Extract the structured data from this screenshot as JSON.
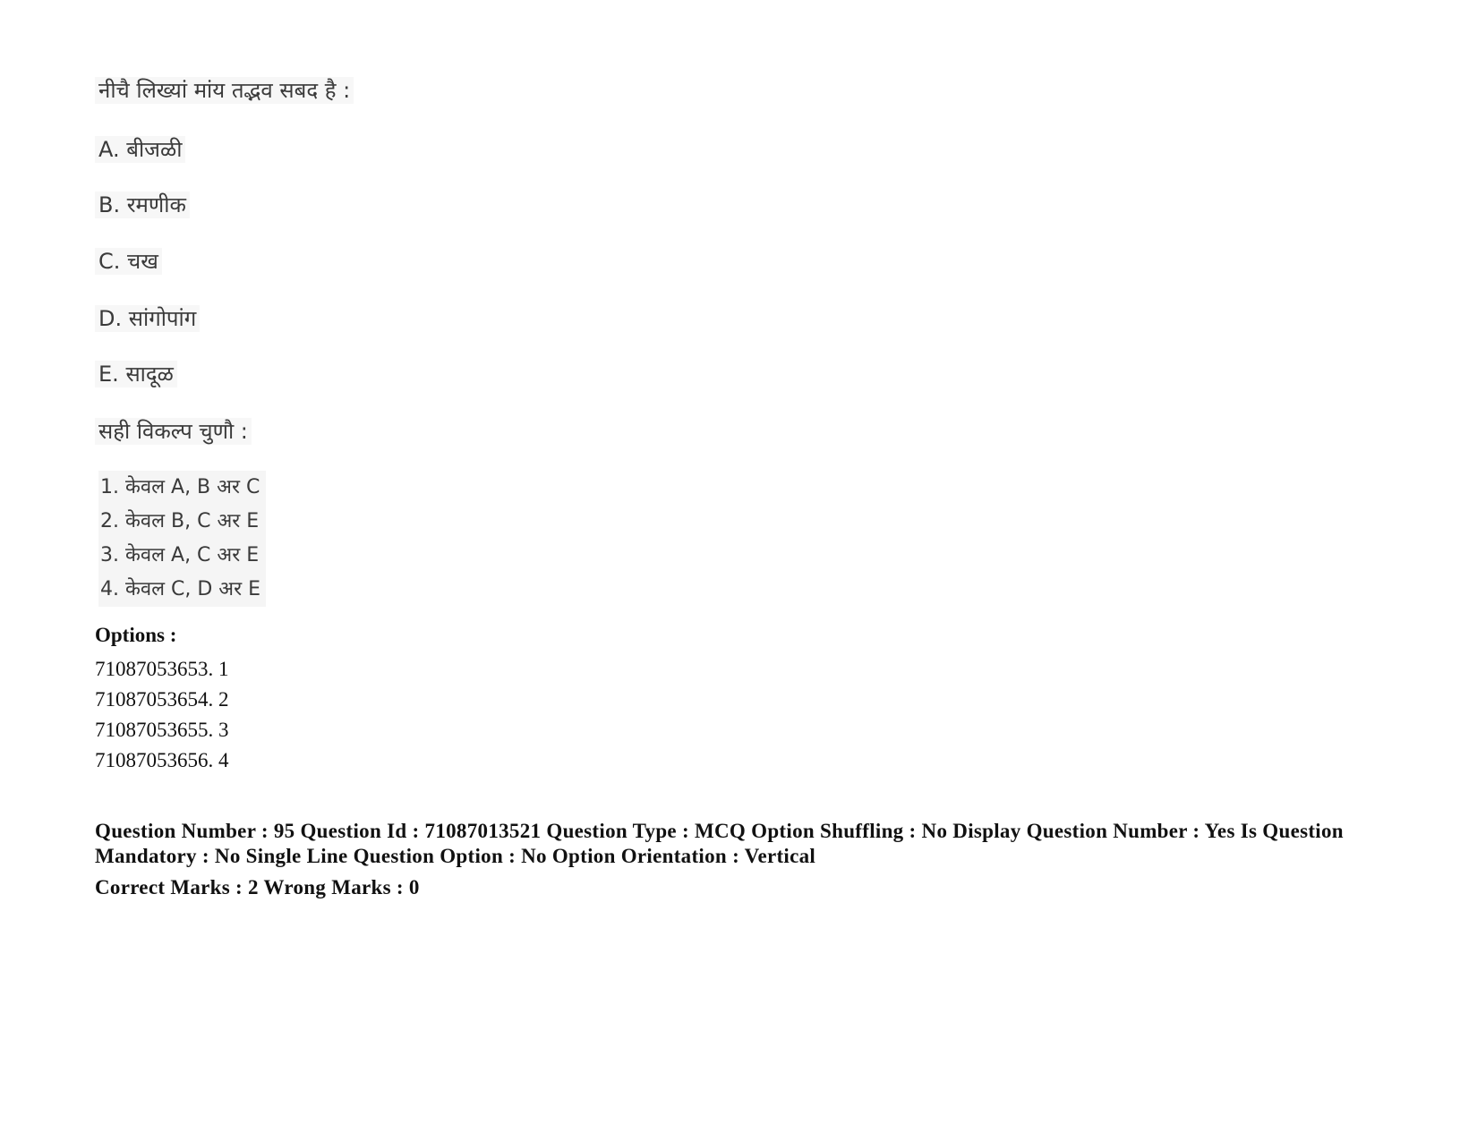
{
  "question": {
    "title": "नीचै लिख्यां मांय तद्भव सबद है :",
    "statements": [
      {
        "label": "A.",
        "text": "बीजळी"
      },
      {
        "label": "B.",
        "text": "रमणीक"
      },
      {
        "label": "C.",
        "text": "चख"
      },
      {
        "label": "D.",
        "text": "सांगोपांग"
      },
      {
        "label": "E.",
        "text": "सादूळ"
      }
    ],
    "prompt": "सही विकल्प चुणौ :",
    "choices": [
      "1. केवल A, B अर C",
      "2. केवल B, C अर E",
      "3. केवल A, C अर E",
      "4. केवल C, D अर E"
    ]
  },
  "options": {
    "label": "Options :",
    "items": [
      "71087053653. 1",
      "71087053654. 2",
      "71087053655. 3",
      "71087053656. 4"
    ]
  },
  "next_question_meta": {
    "line1": "Question Number : 95 Question Id : 71087013521 Question Type : MCQ Option Shuffling : No Display Question Number : Yes Is Question Mandatory : No Single Line Question Option : No Option Orientation : Vertical",
    "marks": "Correct Marks : 2 Wrong Marks : 0"
  }
}
